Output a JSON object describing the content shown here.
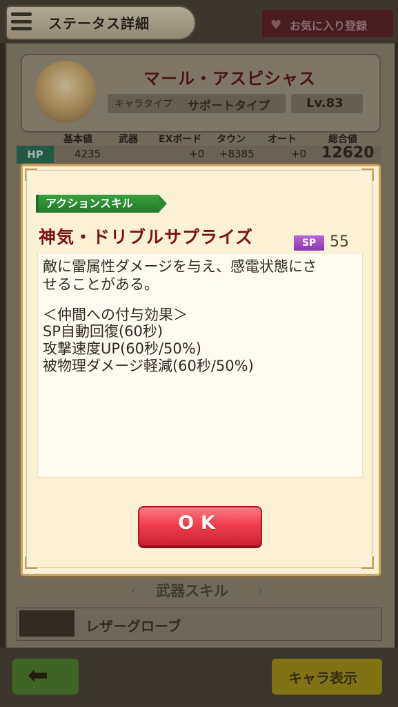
{
  "header": {
    "title": "ステータス詳細",
    "favorite_label": "お気に入り登録"
  },
  "character": {
    "name": "マール・アスピシャス",
    "type_label": "キャラタイプ",
    "type_value": "サポートタイプ",
    "level": "Lv.83"
  },
  "stats": {
    "headers": [
      "基本値",
      "武器",
      "EXボード",
      "タウン",
      "オート",
      "総合値"
    ],
    "hp": {
      "label": "HP",
      "base": "4235",
      "ex_board": "+0",
      "town": "+8385",
      "auto": "+0",
      "total": "12620"
    }
  },
  "dialog": {
    "skill_type": "アクションスキル",
    "skill_name": "神気・ドリブルサプライズ",
    "sp_label": "SP",
    "sp_value": "55",
    "description": [
      "敵に雷属性ダメージを与え、感電状態にさ",
      "せることがある。",
      "",
      "＜仲間への付与効果＞",
      "SP自動回復(60秒)",
      "攻撃速度UP(60秒/50%)",
      "被物理ダメージ軽減(60秒/50%)"
    ],
    "ok_label": "OK"
  },
  "weapon": {
    "section_title": "武器スキル",
    "name": "レザーグローブ"
  },
  "footer": {
    "chara_button": "キャラ表示"
  },
  "icons": {
    "menu": "menu-icon",
    "heart": "heart-icon",
    "back": "back-arrow-icon"
  },
  "colors": {
    "accent_green": "#2a8c31",
    "sp_purple": "#9b45c2",
    "ok_red": "#f0404e",
    "skill_name": "#7a1414"
  }
}
